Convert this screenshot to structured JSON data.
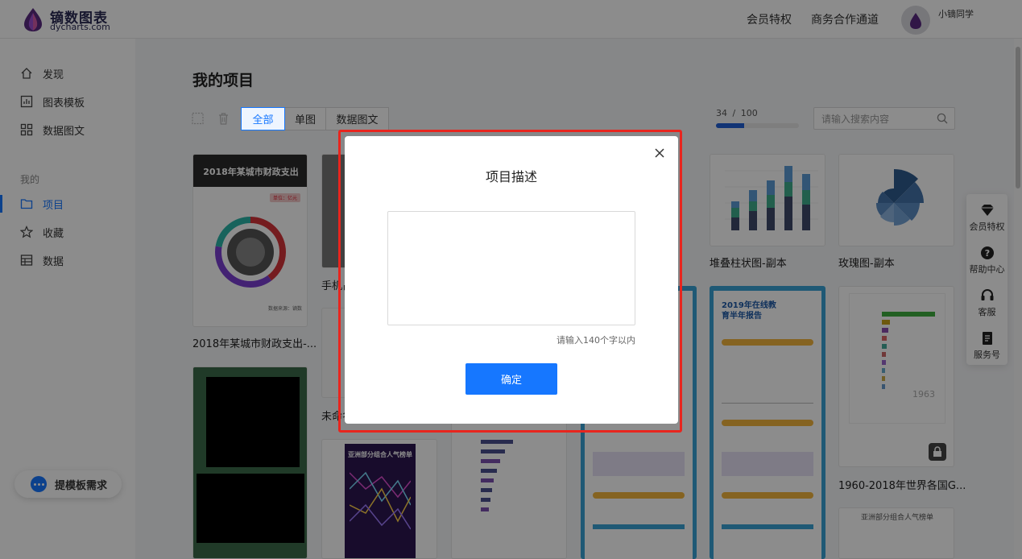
{
  "header": {
    "logo_cn": "镝数图表",
    "logo_en": "dycharts.com",
    "nav": [
      "会员特权",
      "商务合作通道"
    ],
    "username": "小镝同学"
  },
  "sidebar": {
    "items": [
      {
        "label": "发现",
        "icon": "home-icon"
      },
      {
        "label": "图表模板",
        "icon": "chart-icon"
      },
      {
        "label": "数据图文",
        "icon": "grid-icon"
      }
    ],
    "group_label": "我的",
    "my_items": [
      {
        "label": "项目",
        "icon": "folder-icon",
        "active": true
      },
      {
        "label": "收藏",
        "icon": "star-icon"
      },
      {
        "label": "数据",
        "icon": "table-icon"
      }
    ],
    "template_request": "提模板需求"
  },
  "main": {
    "title": "我的项目",
    "tabs": [
      "全部",
      "单图",
      "数据图文"
    ],
    "active_tab": "全部",
    "quota_used": "34",
    "quota_sep": "/",
    "quota_total": "100",
    "quota_fraction": 0.34,
    "search_placeholder": "请输入搜索内容",
    "cards": [
      {
        "title": "2018年某城市财政支出-...",
        "thumb_title": "2018年某城市财政支出",
        "unit": "单位：亿元",
        "source": "数据来源：镝数"
      },
      {
        "title": "手机占"
      },
      {
        "title": "未命名"
      },
      {
        "title": "堆叠柱状图-副本"
      },
      {
        "title": "玫瑰图-副本"
      },
      {
        "title": "1960-2018年世界各国G...",
        "year": "1963"
      },
      {
        "title": "",
        "thumb_title": "2019年在线教育半年报告"
      },
      {
        "title": "",
        "thumb_title": "亚洲部分组合人气榜单"
      },
      {
        "title": "",
        "thumb_title": "亚洲部分组合人气榜单"
      }
    ]
  },
  "float_panel": [
    {
      "label": "会员特权",
      "icon": "diamond-icon"
    },
    {
      "label": "帮助中心",
      "icon": "help-icon"
    },
    {
      "label": "客服",
      "icon": "headset-icon"
    },
    {
      "label": "服务号",
      "icon": "document-icon"
    }
  ],
  "modal": {
    "title": "项目描述",
    "textarea_value": "",
    "hint": "请输入140个字以内",
    "confirm": "确定"
  }
}
